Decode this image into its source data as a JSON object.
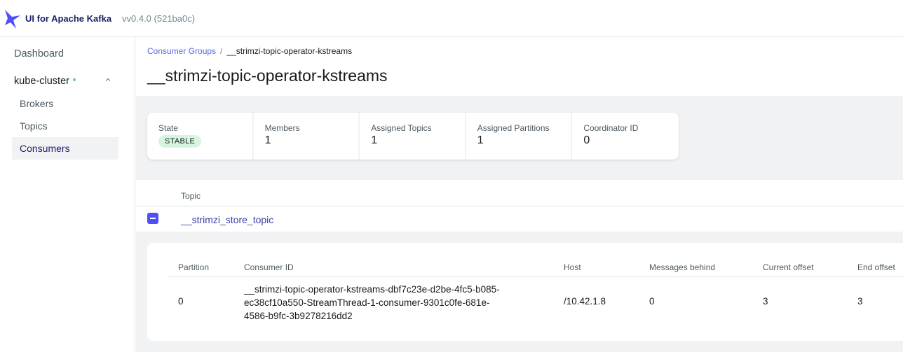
{
  "navbar": {
    "app_title": "UI for Apache Kafka",
    "version": "vv0.4.0 (521ba0c)",
    "logo_icon": "kafka-logo-icon",
    "accent_color": "#4f4ffa"
  },
  "sidebar": {
    "dashboard": "Dashboard",
    "cluster": {
      "name": "kube-cluster",
      "status_color": "#5cd685",
      "items": [
        {
          "label": "Brokers"
        },
        {
          "label": "Topics"
        },
        {
          "label": "Consumers"
        }
      ]
    }
  },
  "breadcrumb": {
    "parent": "Consumer Groups",
    "separator": "/",
    "current": "__strimzi-topic-operator-kstreams"
  },
  "page": {
    "title": "__strimzi-topic-operator-kstreams"
  },
  "metrics": {
    "state_label": "State",
    "state_value": "STABLE",
    "members_label": "Members",
    "members_value": "1",
    "assigned_topics_label": "Assigned Topics",
    "assigned_topics_value": "1",
    "assigned_partitions_label": "Assigned Partitions",
    "assigned_partitions_value": "1",
    "coordinator_label": "Coordinator ID",
    "coordinator_value": "0"
  },
  "topics_table": {
    "header": "Topic",
    "rows": [
      {
        "topic": "__strimzi_store_topic",
        "expanded": true
      }
    ]
  },
  "partitions_table": {
    "headers": [
      "Partition",
      "Consumer ID",
      "Host",
      "Messages behind",
      "Current offset",
      "End offset"
    ],
    "rows": [
      {
        "partition": "0",
        "consumer_id_lines": [
          "__strimzi-topic-operator-kstreams-dbf7c23e-d2be-4fc5-b085-",
          "ec38cf10a550-StreamThread-1-consumer-9301c0fe-681e-",
          "4586-b9fc-3b9278216dd2"
        ],
        "host": "/10.42.1.8",
        "messages_behind": "0",
        "current_offset": "3",
        "end_offset": "3"
      }
    ]
  }
}
